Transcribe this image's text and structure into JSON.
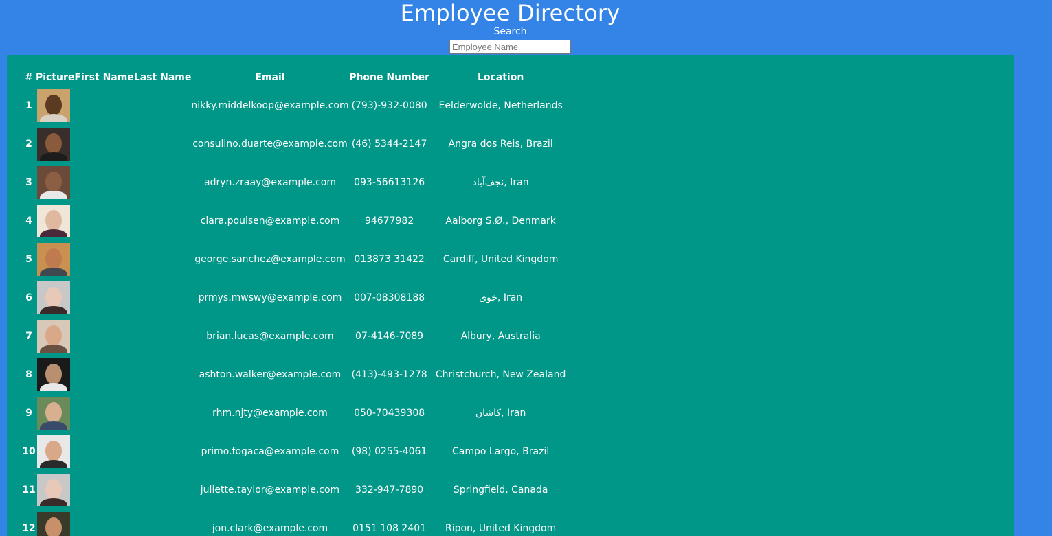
{
  "header": {
    "title": "Employee Directory",
    "search_label": "Search",
    "search_placeholder": "Employee Name"
  },
  "table": {
    "columns": [
      "#",
      "Picture",
      "First Name",
      "Last Name",
      "Email",
      "Phone Number",
      "Location"
    ],
    "rows": [
      {
        "num": "1",
        "email": "nikky.middelkoop@example.com",
        "phone": "(793)-932-0080",
        "location": "Eelderwolde, Netherlands",
        "avatar": {
          "bg": "#c9a36b",
          "face": "#5b3a22",
          "body": "#d9d2c4"
        }
      },
      {
        "num": "2",
        "email": "consulino.duarte@example.com",
        "phone": "(46) 5344-2147",
        "location": "Angra dos Reis, Brazil",
        "avatar": {
          "bg": "#3a2e2a",
          "face": "#8a5a3c",
          "body": "#1c1c1c"
        }
      },
      {
        "num": "3",
        "email": "adryn.zraay@example.com",
        "phone": "093-56613126",
        "location": "نجف‌آباد, Iran",
        "avatar": {
          "bg": "#6b4a3a",
          "face": "#8c5e43",
          "body": "#e8e8e8"
        }
      },
      {
        "num": "4",
        "email": "clara.poulsen@example.com",
        "phone": "94677982",
        "location": "Aalborg S.Ø., Denmark",
        "avatar": {
          "bg": "#f0e6d8",
          "face": "#e0b8a0",
          "body": "#4a2a3a"
        }
      },
      {
        "num": "5",
        "email": "george.sanchez@example.com",
        "phone": "013873 31422",
        "location": "Cardiff, United Kingdom",
        "avatar": {
          "bg": "#c99050",
          "face": "#c07a50",
          "body": "#404850"
        }
      },
      {
        "num": "6",
        "email": "prmys.mwswy@example.com",
        "phone": "007-08308188",
        "location": "خوی, Iran",
        "avatar": {
          "bg": "#c8c8c8",
          "face": "#e8c8b8",
          "body": "#3a2a2a"
        }
      },
      {
        "num": "7",
        "email": "brian.lucas@example.com",
        "phone": "07-4146-7089",
        "location": "Albury, Australia",
        "avatar": {
          "bg": "#d8c8b8",
          "face": "#d8a888",
          "body": "#6a5040"
        }
      },
      {
        "num": "8",
        "email": "ashton.walker@example.com",
        "phone": "(413)-493-1278",
        "location": "Christchurch, New Zealand",
        "avatar": {
          "bg": "#1a1a1a",
          "face": "#b89070",
          "body": "#e8e8e8"
        }
      },
      {
        "num": "9",
        "email": "rhm.njty@example.com",
        "phone": "050-70439308",
        "location": "کاشان, Iran",
        "avatar": {
          "bg": "#6a8a5a",
          "face": "#d8b090",
          "body": "#3a4a6a"
        }
      },
      {
        "num": "10",
        "email": "primo.fogaca@example.com",
        "phone": "(98) 0255-4061",
        "location": "Campo Largo, Brazil",
        "avatar": {
          "bg": "#e8e8e8",
          "face": "#d8a888",
          "body": "#2a2a2a"
        }
      },
      {
        "num": "11",
        "email": "juliette.taylor@example.com",
        "phone": "332-947-7890",
        "location": "Springfield, Canada",
        "avatar": {
          "bg": "#c8c8c8",
          "face": "#e8c8b8",
          "body": "#3a2a2a"
        }
      },
      {
        "num": "12",
        "email": "jon.clark@example.com",
        "phone": "0151 108 2401",
        "location": "Ripon, United Kingdom",
        "avatar": {
          "bg": "#3a3a2a",
          "face": "#c8906a",
          "body": "#5a4a3a"
        }
      }
    ]
  }
}
